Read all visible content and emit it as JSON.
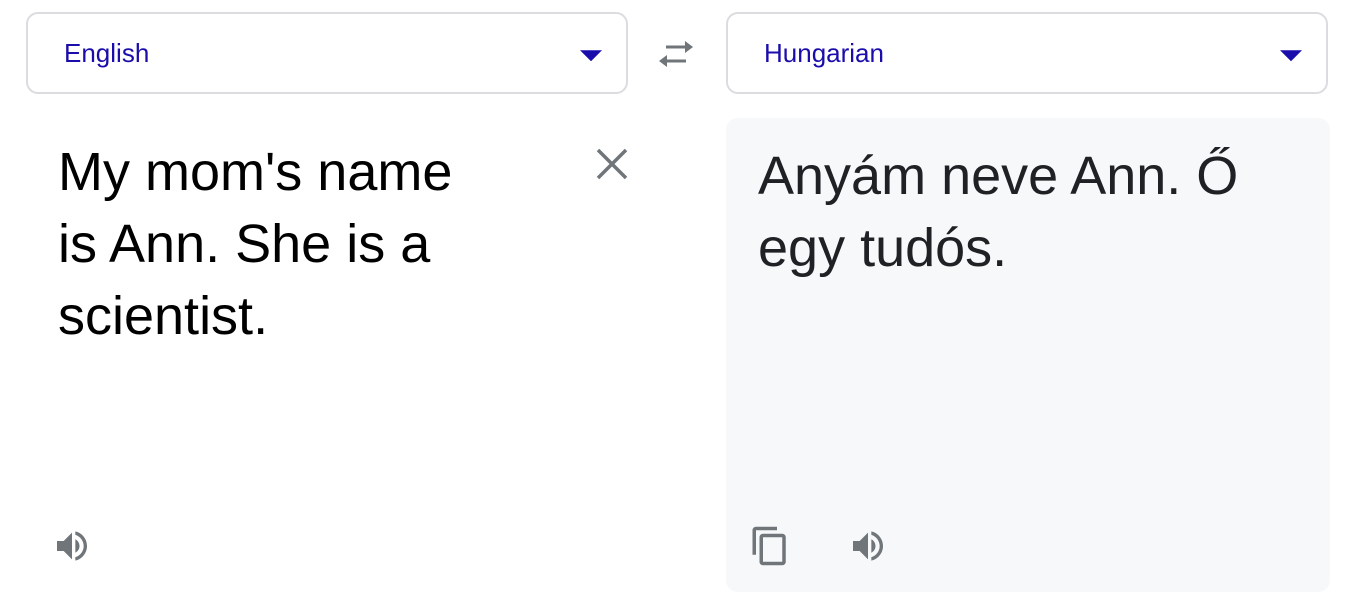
{
  "source": {
    "language": "English",
    "text": "My mom's name is Ann. She is a scientist.",
    "clear_icon": "close-icon",
    "speak_icon": "volume-icon"
  },
  "target": {
    "language": "Hungarian",
    "text": "Anyám neve Ann. Ő egy tudós.",
    "copy_icon": "copy-icon",
    "speak_icon": "volume-icon"
  },
  "swap_icon": "swap-arrows-icon",
  "colors": {
    "link_blue": "#1a0dab",
    "icon_gray": "#70757a",
    "border": "#dadce0",
    "target_bg": "#f7f8fa"
  }
}
